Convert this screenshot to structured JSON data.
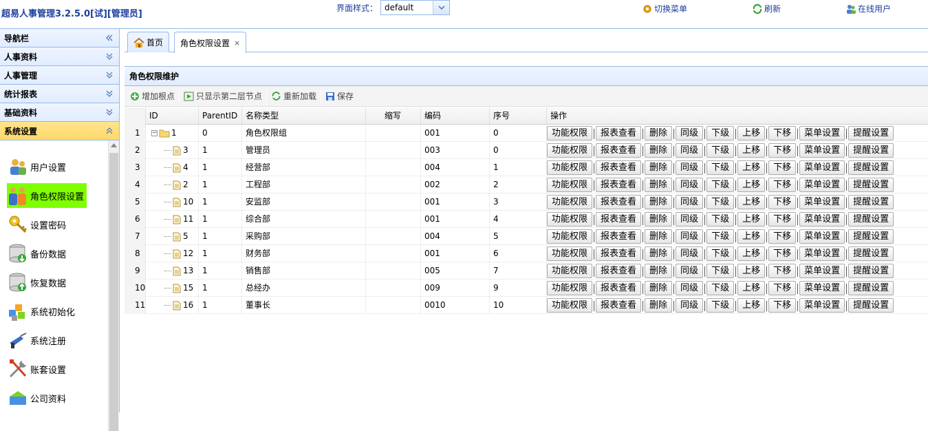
{
  "header": {
    "app_title": "超易人事管理3.2.5.0[试][管理员]",
    "style_label": "界面样式：",
    "style_value": "default",
    "switch_menu": "切换菜单",
    "refresh": "刷新",
    "online_users": "在线用户"
  },
  "nav": {
    "title": "导航栏",
    "sections": [
      "人事资料",
      "人事管理",
      "统计报表",
      "基础资料",
      "系统设置"
    ],
    "items": [
      "用户设置",
      "角色权限设置",
      "设置密码",
      "备份数据",
      "恢复数据",
      "系统初始化",
      "系统注册",
      "账套设置",
      "公司资料"
    ]
  },
  "tabs": {
    "home": "首页",
    "role": "角色权限设置",
    "close": "×"
  },
  "panel": {
    "title": "角色权限维护",
    "toolbar": {
      "add_root": "增加根点",
      "show_second": "只显示第二层节点",
      "reload": "重新加载",
      "save": "保存"
    }
  },
  "grid": {
    "headers": [
      "ID",
      "ParentID",
      "名称类型",
      "缩写",
      "编码",
      "序号",
      "操作"
    ],
    "ops": [
      "功能权限",
      "报表查看",
      "删除",
      "同级",
      "下级",
      "上移",
      "下移",
      "菜单设置",
      "提醒设置"
    ],
    "rows": [
      {
        "n": "1",
        "id": "1",
        "pid": "0",
        "name": "角色权限组",
        "abbr": "",
        "code": "001",
        "seq": "0"
      },
      {
        "n": "2",
        "id": "3",
        "pid": "1",
        "name": "管理员",
        "abbr": "",
        "code": "003",
        "seq": "0"
      },
      {
        "n": "3",
        "id": "4",
        "pid": "1",
        "name": "经营部",
        "abbr": "",
        "code": "004",
        "seq": "1"
      },
      {
        "n": "4",
        "id": "2",
        "pid": "1",
        "name": "工程部",
        "abbr": "",
        "code": "002",
        "seq": "2"
      },
      {
        "n": "5",
        "id": "10",
        "pid": "1",
        "name": "安监部",
        "abbr": "",
        "code": "001",
        "seq": "3"
      },
      {
        "n": "6",
        "id": "11",
        "pid": "1",
        "name": "综合部",
        "abbr": "",
        "code": "001",
        "seq": "4"
      },
      {
        "n": "7",
        "id": "5",
        "pid": "1",
        "name": "采购部",
        "abbr": "",
        "code": "004",
        "seq": "5"
      },
      {
        "n": "8",
        "id": "12",
        "pid": "1",
        "name": "财务部",
        "abbr": "",
        "code": "001",
        "seq": "6"
      },
      {
        "n": "9",
        "id": "13",
        "pid": "1",
        "name": "销售部",
        "abbr": "",
        "code": "005",
        "seq": "7"
      },
      {
        "n": "10",
        "id": "15",
        "pid": "1",
        "name": "总经办",
        "abbr": "",
        "code": "009",
        "seq": "9"
      },
      {
        "n": "11",
        "id": "16",
        "pid": "1",
        "name": "董事长",
        "abbr": "",
        "code": "0010",
        "seq": "10"
      }
    ]
  }
}
